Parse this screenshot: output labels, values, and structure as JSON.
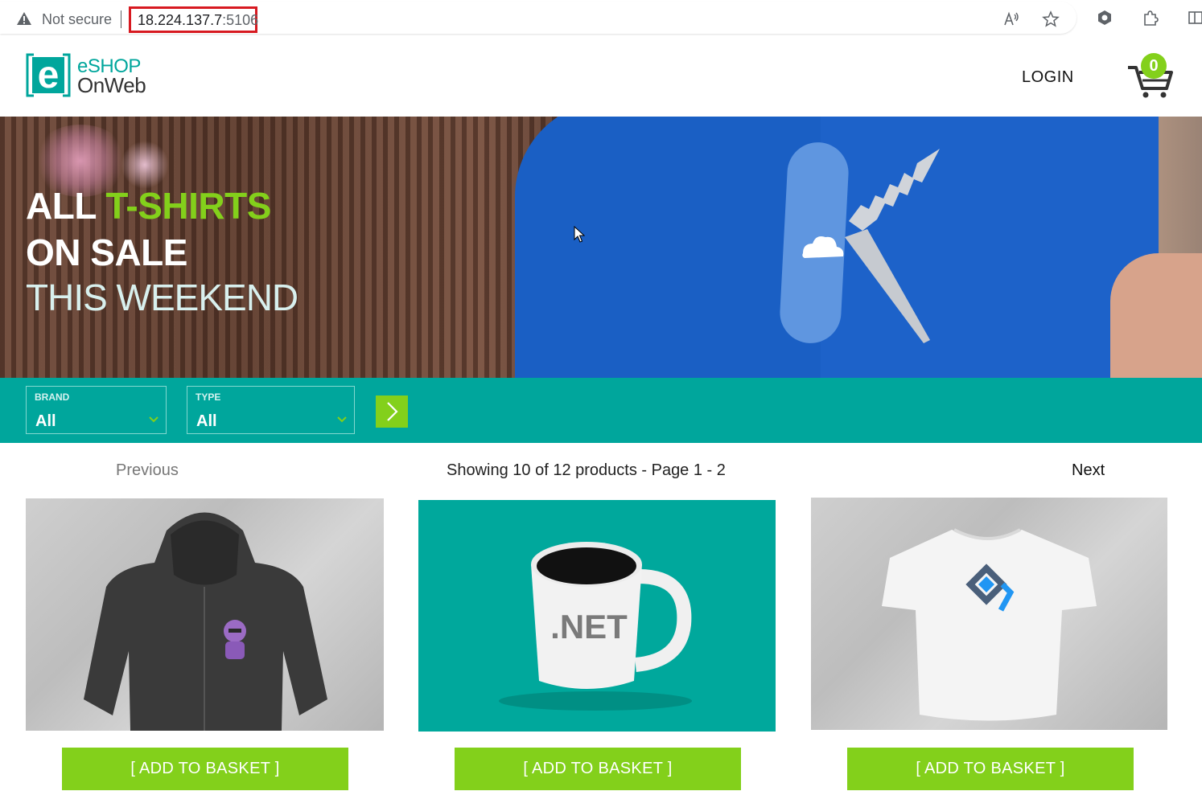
{
  "browser": {
    "security_label": "Not secure",
    "url_host": "18.224.137.7",
    "url_port": ":5106"
  },
  "header": {
    "logo_line1": "eSHOP",
    "logo_line2": "OnWeb",
    "login_label": "LOGIN",
    "cart_count": "0"
  },
  "hero": {
    "line1_a": "ALL ",
    "line1_b": "T-SHIRTS",
    "line2": "ON SALE",
    "line3": "THIS WEEKEND"
  },
  "filters": {
    "brand_label": "BRAND",
    "brand_value": "All",
    "type_label": "TYPE",
    "type_value": "All"
  },
  "pager": {
    "previous": "Previous",
    "info": "Showing 10 of 12 products - Page 1 - 2",
    "next": "Next"
  },
  "products": [
    {
      "image": "hoodie-image",
      "button": "[ ADD TO BASKET ]"
    },
    {
      "image": "net-mug-image",
      "mug_text": ".NET",
      "button": "[ ADD TO BASKET ]"
    },
    {
      "image": "tshirt-image",
      "button": "[ ADD TO BASKET ]"
    }
  ],
  "colors": {
    "brand_teal": "#00a69c",
    "accent_green": "#83d01b",
    "url_highlight": "#d71920"
  }
}
